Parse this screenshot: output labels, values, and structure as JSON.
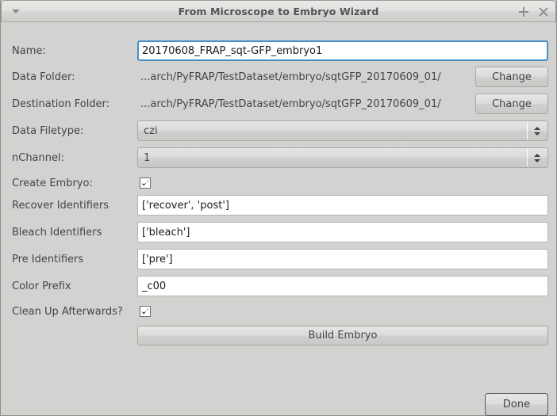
{
  "window": {
    "title": "From Microscope to Embryo Wizard",
    "menu_icon": "triangle-down-icon",
    "maximize_icon": "plus-icon",
    "close_icon": "close-icon"
  },
  "form": {
    "name": {
      "label": "Name:",
      "value": "20170608_FRAP_sqt-GFP_embryo1",
      "placeholder": ""
    },
    "data_folder": {
      "label": "Data Folder:",
      "path": "...arch/PyFRAP/TestDataset/embryo/sqtGFP_20170609_01/",
      "button": "Change"
    },
    "destination_folder": {
      "label": "Destination Folder:",
      "path": "...arch/PyFRAP/TestDataset/embryo/sqtGFP_20170609_01/",
      "button": "Change"
    },
    "data_filetype": {
      "label": "Data Filetype:",
      "value": "czi"
    },
    "nchannel": {
      "label": "nChannel:",
      "value": "1"
    },
    "create_embryo": {
      "label": "Create Embryo:",
      "checked": "true"
    },
    "recover_identifiers": {
      "label": "Recover Identifiers",
      "value": "['recover', 'post']",
      "placeholder": ""
    },
    "bleach_identifiers": {
      "label": "Bleach Identifiers",
      "value": "['bleach']",
      "placeholder": ""
    },
    "pre_identifiers": {
      "label": "Pre Identifiers",
      "value": "['pre']",
      "placeholder": ""
    },
    "color_prefix": {
      "label": "Color Prefix",
      "value": "_c00",
      "placeholder": ""
    },
    "clean_up": {
      "label": "Clean Up Afterwards?",
      "checked": "true"
    },
    "build_embryo_button": "Build Embryo",
    "done_button": "Done"
  },
  "colors": {
    "window_bg": "#d2d2d0",
    "titlebar_text": "#51555a",
    "label_text": "#41464b",
    "focus_border": "#4a90c8",
    "input_bg": "#ffffff"
  }
}
